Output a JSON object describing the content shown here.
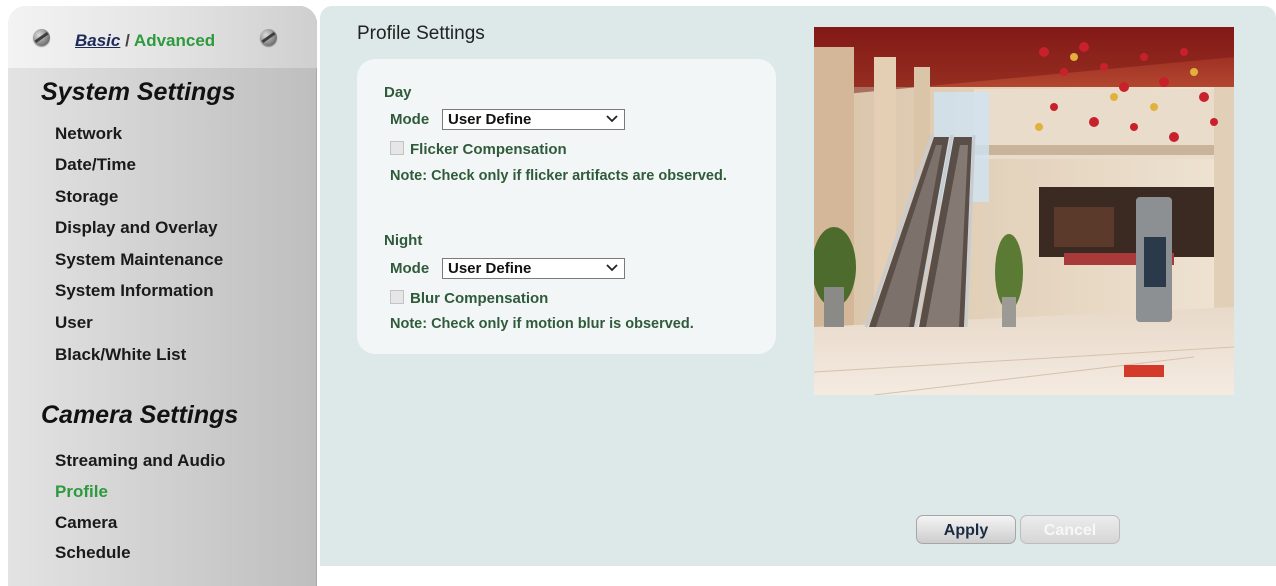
{
  "mode_switch": {
    "basic": "Basic",
    "sep": " / ",
    "advanced": "Advanced"
  },
  "sidebar": {
    "system_title": "System Settings",
    "system_items": [
      "Network",
      "Date/Time",
      "Storage",
      "Display and Overlay",
      "System Maintenance",
      "System Information",
      "User",
      "Black/White List"
    ],
    "camera_title": "Camera Settings",
    "camera_items": [
      "Streaming and Audio",
      "Profile",
      "Camera",
      "Schedule"
    ],
    "active_item": "Profile"
  },
  "main": {
    "title": "Profile Settings",
    "day": {
      "title": "Day",
      "mode_label": "Mode",
      "mode_value": "User Define",
      "checkbox_label": "Flicker Compensation",
      "checkbox_checked": false,
      "note": "Note: Check only if flicker artifacts are observed."
    },
    "night": {
      "title": "Night",
      "mode_label": "Mode",
      "mode_value": "User Define",
      "checkbox_label": "Blur Compensation",
      "checkbox_checked": false,
      "note": "Note: Check only if motion blur is observed."
    }
  },
  "buttons": {
    "apply": "Apply",
    "cancel": "Cancel"
  },
  "colors": {
    "accent_green": "#2e9a3e",
    "text_green": "#2f5b3b",
    "panel_bg": "#dce9e8"
  }
}
